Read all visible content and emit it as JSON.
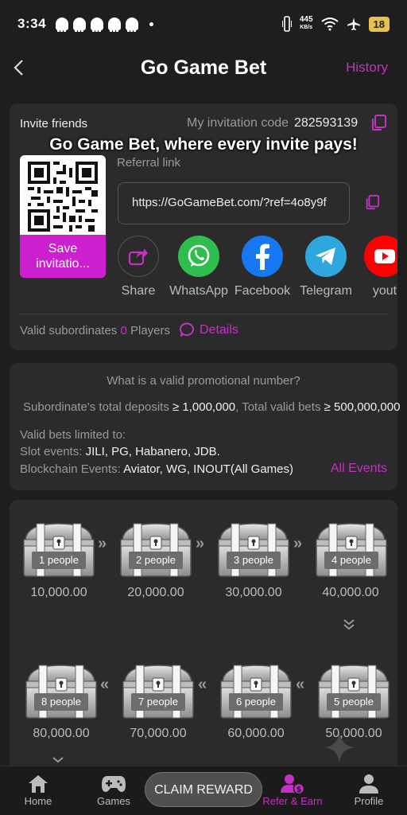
{
  "status": {
    "time": "3:34",
    "net_speed": "445",
    "net_unit": "KB/s",
    "battery": "18"
  },
  "header": {
    "title": "Go Game Bet",
    "history": "History"
  },
  "invite": {
    "label": "Invite friends",
    "code_label": "My invitation code",
    "code": "282593139",
    "banner": "Go Game Bet, where every invite pays!",
    "referral_label": "Referral link",
    "referral_link": "https://GoGameBet.com/?ref=4o8y9f",
    "save_button": "Save invitatio...",
    "share": [
      {
        "label": "Share",
        "icon": "share-icon"
      },
      {
        "label": "WhatsApp",
        "icon": "whatsapp-icon"
      },
      {
        "label": "Facebook",
        "icon": "facebook-icon"
      },
      {
        "label": "Telegram",
        "icon": "telegram-icon"
      },
      {
        "label": "yout",
        "icon": "youtube-icon"
      }
    ],
    "valid_label": "Valid subordinates",
    "valid_count": "0",
    "valid_unit": "Players",
    "details": "Details"
  },
  "promo": {
    "question": "What is a valid promotional number?",
    "deposit_label": "Subordinate's total deposits",
    "deposit_value": "≥ 1,000,000",
    "bets_label": "Total valid bets",
    "bets_value": "≥ 500,000,000",
    "limited_label": "Valid bets limited to:",
    "slot_label": "Slot events:",
    "slot_value": "JILI, PG, Habanero, JDB.",
    "chain_label": "Blockchain Events:",
    "chain_value": "Aviator, WG, INOUT(All Games)",
    "all_events": "All Events"
  },
  "rewards": [
    {
      "people": "1 people",
      "amount": "10,000.00"
    },
    {
      "people": "2 people",
      "amount": "20,000.00"
    },
    {
      "people": "3 people",
      "amount": "30,000.00"
    },
    {
      "people": "4 people",
      "amount": "40,000.00"
    },
    {
      "people": "8 people",
      "amount": "80,000.00"
    },
    {
      "people": "7 people",
      "amount": "70,000.00"
    },
    {
      "people": "6 people",
      "amount": "60,000.00"
    },
    {
      "people": "5 people",
      "amount": "50,000.00"
    }
  ],
  "nav": {
    "home": "Home",
    "games": "Games",
    "claim": "CLAIM REWARD",
    "refer": "Refer & Earn",
    "profile": "Profile"
  },
  "colors": {
    "accent": "#c431c4",
    "save_button": "#cc1fd0",
    "background": "#1e1e1e",
    "card": "#2b2b2b"
  }
}
